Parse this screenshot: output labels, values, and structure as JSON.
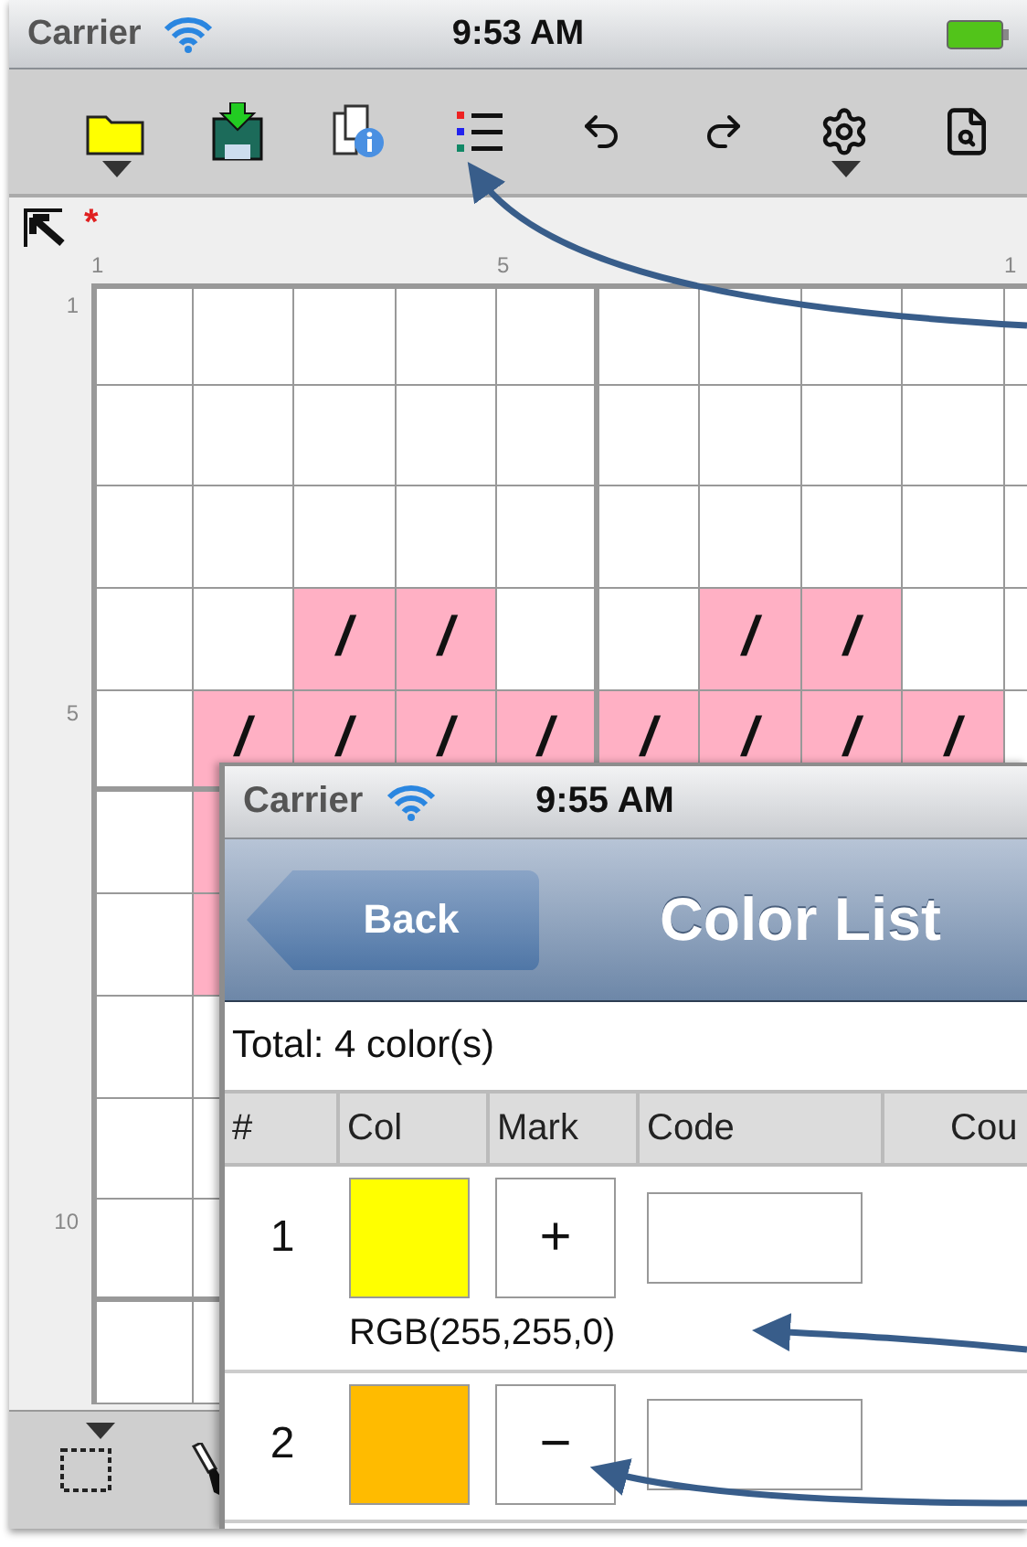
{
  "status_bar": {
    "carrier": "Carrier",
    "time": "9:53 AM"
  },
  "toolbar": [
    {
      "kind": "folder",
      "dropdown": true
    },
    {
      "kind": "save",
      "dropdown": false
    },
    {
      "kind": "info",
      "dropdown": false
    },
    {
      "kind": "color-list",
      "dropdown": false
    },
    {
      "kind": "undo",
      "dropdown": false
    },
    {
      "kind": "redo",
      "dropdown": false
    },
    {
      "kind": "settings",
      "dropdown": true
    },
    {
      "kind": "preview",
      "dropdown": false
    }
  ],
  "ruler": {
    "modified_mark": "*"
  },
  "grid": {
    "columns": [
      {
        "label": "1"
      },
      {},
      {},
      {},
      {
        "label": "5"
      },
      {},
      {},
      {},
      {},
      {
        "label": "1"
      }
    ],
    "rows": [
      {
        "label": "1",
        "cells": [
          {
            "filled": false
          },
          {
            "filled": false
          },
          {
            "filled": false
          },
          {
            "filled": false
          },
          {
            "filled": false
          },
          {
            "filled": false
          },
          {
            "filled": false
          },
          {
            "filled": false
          },
          {
            "filled": false
          },
          {
            "filled": false
          }
        ]
      },
      {
        "cells": [
          {
            "filled": false
          },
          {
            "filled": false
          },
          {
            "filled": false
          },
          {
            "filled": false
          },
          {
            "filled": false
          },
          {
            "filled": false
          },
          {
            "filled": false
          },
          {
            "filled": false
          },
          {
            "filled": false
          },
          {
            "filled": false
          }
        ]
      },
      {
        "cells": [
          {
            "filled": false
          },
          {
            "filled": false
          },
          {
            "filled": false
          },
          {
            "filled": false
          },
          {
            "filled": false
          },
          {
            "filled": false
          },
          {
            "filled": false
          },
          {
            "filled": false
          },
          {
            "filled": false
          },
          {
            "filled": false
          }
        ]
      },
      {
        "cells": [
          {
            "filled": false
          },
          {
            "filled": false
          },
          {
            "filled": true,
            "mark": "/"
          },
          {
            "filled": true,
            "mark": "/"
          },
          {
            "filled": false
          },
          {
            "filled": false
          },
          {
            "filled": true,
            "mark": "/"
          },
          {
            "filled": true,
            "mark": "/"
          },
          {
            "filled": false
          },
          {
            "filled": false
          }
        ]
      },
      {
        "label": "5",
        "cells": [
          {
            "filled": false
          },
          {
            "filled": true,
            "mark": "/"
          },
          {
            "filled": true,
            "mark": "/"
          },
          {
            "filled": true,
            "mark": "/"
          },
          {
            "filled": true,
            "mark": "/"
          },
          {
            "filled": true,
            "mark": "/"
          },
          {
            "filled": true,
            "mark": "/"
          },
          {
            "filled": true,
            "mark": "/"
          },
          {
            "filled": true,
            "mark": "/"
          },
          {
            "filled": false
          }
        ]
      },
      {
        "cells": [
          {
            "filled": false
          },
          {
            "filled": true
          }
        ]
      },
      {
        "cells": [
          {
            "filled": false
          },
          {
            "filled": true
          }
        ]
      },
      {
        "cells": [
          {
            "filled": false
          },
          {
            "filled": false
          }
        ]
      },
      {
        "cells": [
          {
            "filled": false
          },
          {
            "filled": false
          }
        ]
      },
      {
        "label": "10",
        "cells": [
          {
            "filled": false
          },
          {
            "filled": false
          }
        ]
      },
      {
        "cells": [
          {
            "filled": false
          },
          {
            "filled": false
          }
        ]
      }
    ]
  },
  "bottom_toolbar": [
    {
      "kind": "select",
      "dropdown": true
    },
    {
      "kind": "eyedropper"
    }
  ],
  "color_list_screen": {
    "status_bar": {
      "carrier": "Carrier",
      "time": "9:55 AM"
    },
    "nav": {
      "back": "Back",
      "title": "Color List"
    },
    "total": "Total: 4 color(s)",
    "columns": [
      "#",
      "Col",
      "Mark",
      "Code",
      "Cou"
    ],
    "rows": [
      {
        "number": "1",
        "color": "#ffff00",
        "mark": "+",
        "rgb": "RGB(255,255,0)"
      },
      {
        "number": "2",
        "color": "#ffbb00",
        "mark": "−"
      }
    ]
  }
}
